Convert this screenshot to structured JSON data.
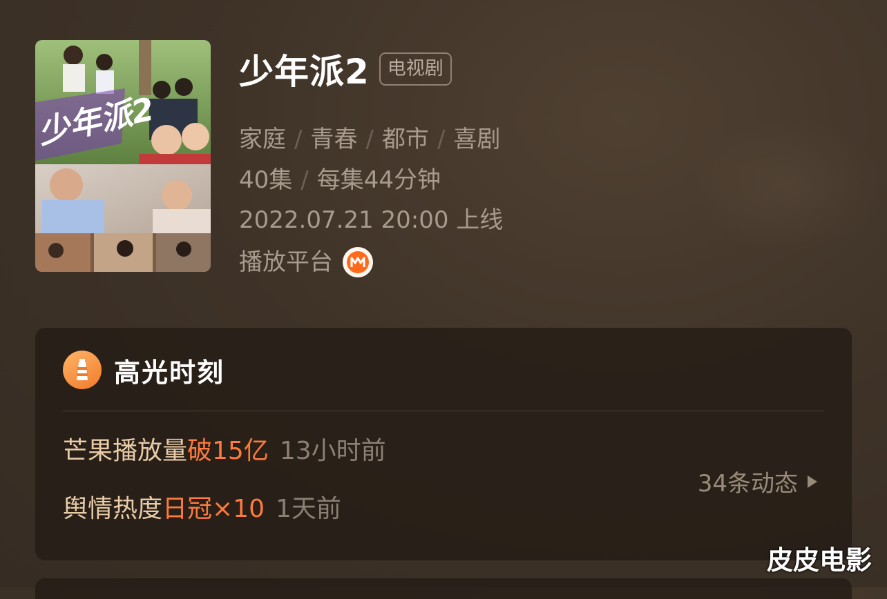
{
  "show": {
    "title": "少年派2",
    "type_badge": "电视剧",
    "genres": [
      "家庭",
      "青春",
      "都市",
      "喜剧"
    ],
    "episodes": "40集",
    "episode_length": "每集44分钟",
    "release": "2022.07.21 20:00 上线",
    "platform_label": "播放平台",
    "platform_icon": "mango-tv-logo-icon"
  },
  "poster": {
    "title_art": "少年派2"
  },
  "highlights": {
    "title": "高光时刻",
    "icon": "lighthouse-icon",
    "items": [
      {
        "label": "芒果播放量",
        "accent": "破15亿",
        "time": "13小时前"
      },
      {
        "label": "舆情热度",
        "accent": "日冠×10",
        "time": "1天前"
      }
    ],
    "more_label": "34条动态"
  },
  "watermark": "皮皮电影",
  "colors": {
    "background": "#3f3328",
    "accent": "#ff7a3c",
    "highlight_label": "#e8cba7",
    "meta_text": "#a79b8d"
  }
}
